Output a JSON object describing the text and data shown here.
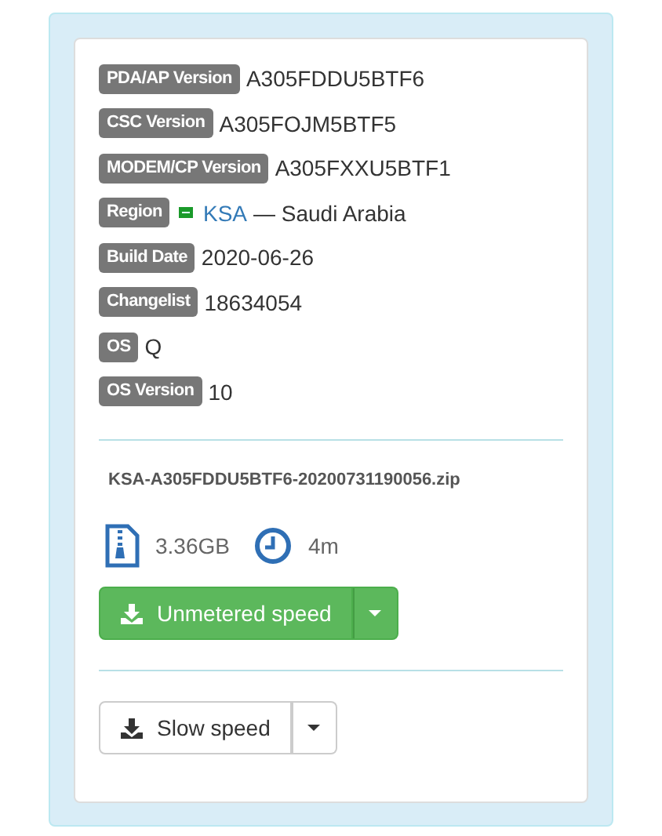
{
  "details": [
    {
      "kind": "text",
      "label": "PDA/AP Version",
      "value": "A305FDDU5BTF6"
    },
    {
      "kind": "text",
      "label": "CSC Version",
      "value": "A305FOJM5BTF5"
    },
    {
      "kind": "text",
      "label": "MODEM/CP Version",
      "value": "A305FXXU5BTF1"
    },
    {
      "kind": "region",
      "label": "Region",
      "code": "KSA",
      "value": "— Saudi Arabia"
    },
    {
      "kind": "text",
      "label": "Build Date",
      "value": "2020-06-26"
    },
    {
      "kind": "text",
      "label": "Changelist",
      "value": "18634054"
    },
    {
      "kind": "text",
      "label": "OS",
      "value": "Q"
    },
    {
      "kind": "text",
      "label": "OS Version",
      "value": "10"
    }
  ],
  "file": {
    "name": "KSA-A305FDDU5BTF6-20200731190056.zip",
    "size": "3.36GB",
    "time": "4m"
  },
  "downloads": [
    {
      "kind": "success",
      "label": "Unmetered speed"
    },
    {
      "kind": "default",
      "label": "Slow speed"
    }
  ]
}
